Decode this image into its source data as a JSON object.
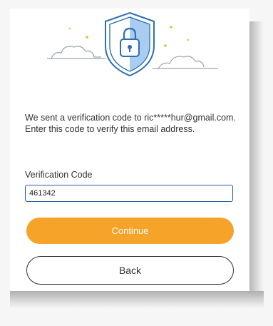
{
  "dialog": {
    "message": "We sent a verification code to ric*****hur@gmail.com. Enter this code to verify this email address.",
    "code_label": "Verification Code",
    "code_value": "461342",
    "continue_label": "Continue",
    "back_label": "Back"
  },
  "illustration": {
    "icon": "shield-lock-icon"
  },
  "colors": {
    "accent": "#f6a32a",
    "shield": "#2f6eb5",
    "shield_fill": "#a9cdf0",
    "input_border": "#1f5fa8"
  }
}
